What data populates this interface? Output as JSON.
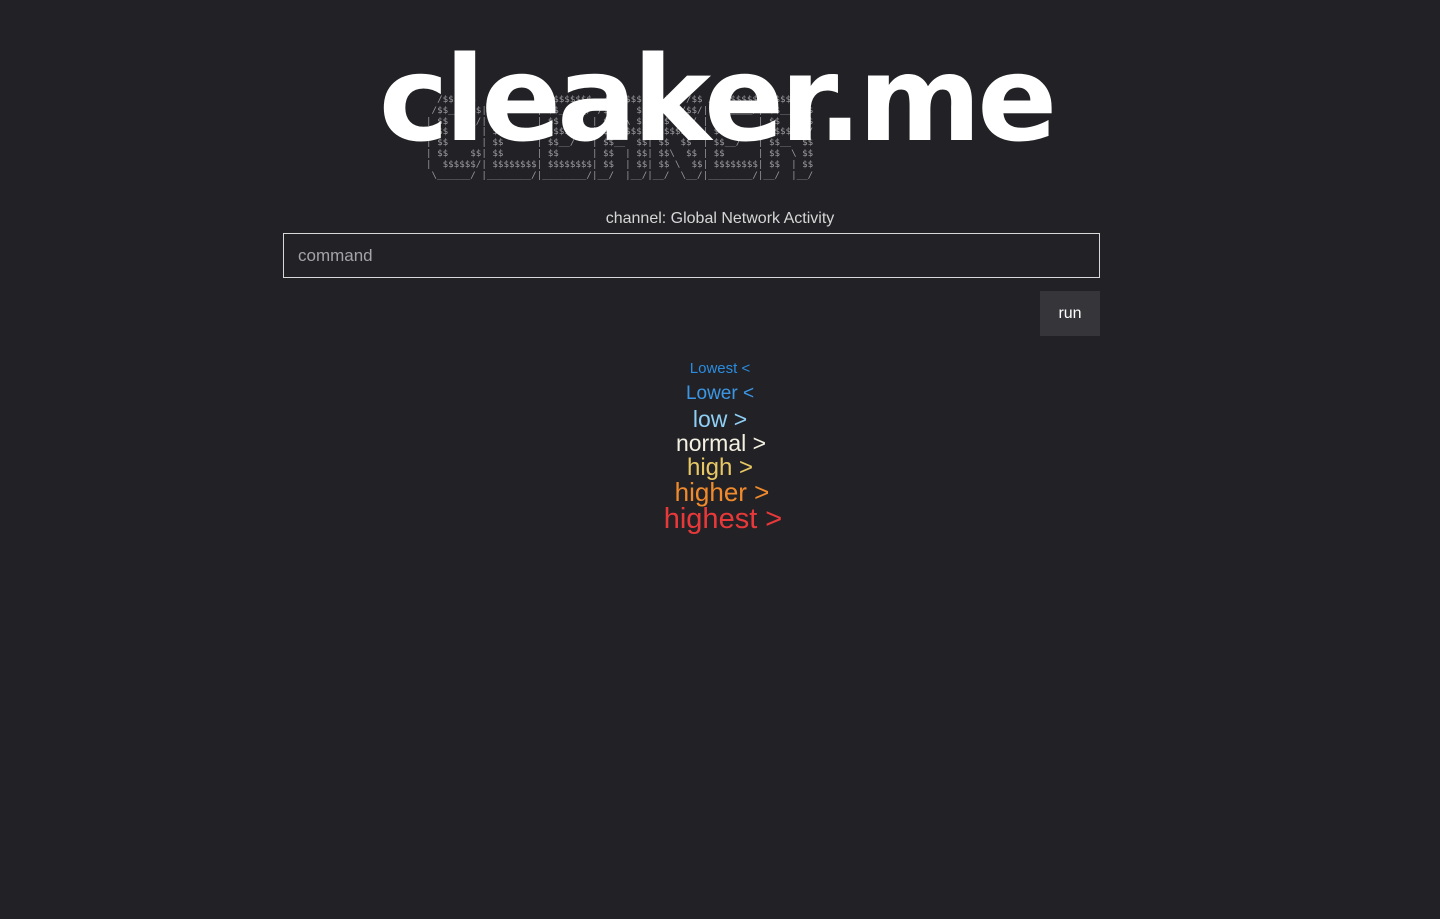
{
  "logo": {
    "title": "cleaker.me",
    "ascii_art": "  /$$$$$$  /$$       /$$$$$$$$  /$$$$$$  /$$   /$$ /$$$$$$$$ /$$$$$$$ \n /$$__  $$| $$      | $$_____/ /$$__  $$| $$  /$$/| $$_____/| $$__  $$\n| $$  \\__/| $$      | $$      | $$  \\ $$| $$ /$$/ | $$      | $$  \\ $$\n| $$      | $$      | $$$$$   | $$$$$$$$| $$$$$/  | $$$$$   | $$$$$$$/\n| $$      | $$      | $$__/   | $$__  $$| $$  $$  | $$__/   | $$__  $$\n| $$    $$| $$      | $$      | $$  | $$| $$\\  $$ | $$      | $$  \\ $$\n|  $$$$$$/| $$$$$$$$| $$$$$$$$| $$  | $$| $$ \\  $$| $$$$$$$$| $$  | $$\n \\______/ |________/|________/|__/  |__/|__/  \\__/|________/|__/  |__/"
  },
  "channel": {
    "label": "channel: Global Network Activity"
  },
  "command": {
    "placeholder": "command",
    "value": ""
  },
  "run_button": {
    "label": "run"
  },
  "levels": [
    {
      "key": "lowest",
      "label": "Lowest <",
      "color": "#2a8ce0"
    },
    {
      "key": "lower",
      "label": "Lower <",
      "color": "#3b97e6"
    },
    {
      "key": "low",
      "label": "low >",
      "color": "#8fcff6"
    },
    {
      "key": "normal",
      "label": "normal >",
      "color": "#f4f0e2"
    },
    {
      "key": "high",
      "label": "high >",
      "color": "#e8c864"
    },
    {
      "key": "higher",
      "label": "higher >",
      "color": "#f08a2c"
    },
    {
      "key": "highest",
      "label": "highest >",
      "color": "#e8383a"
    }
  ],
  "theme": {
    "background": "#222226",
    "button_background": "#35353a"
  }
}
